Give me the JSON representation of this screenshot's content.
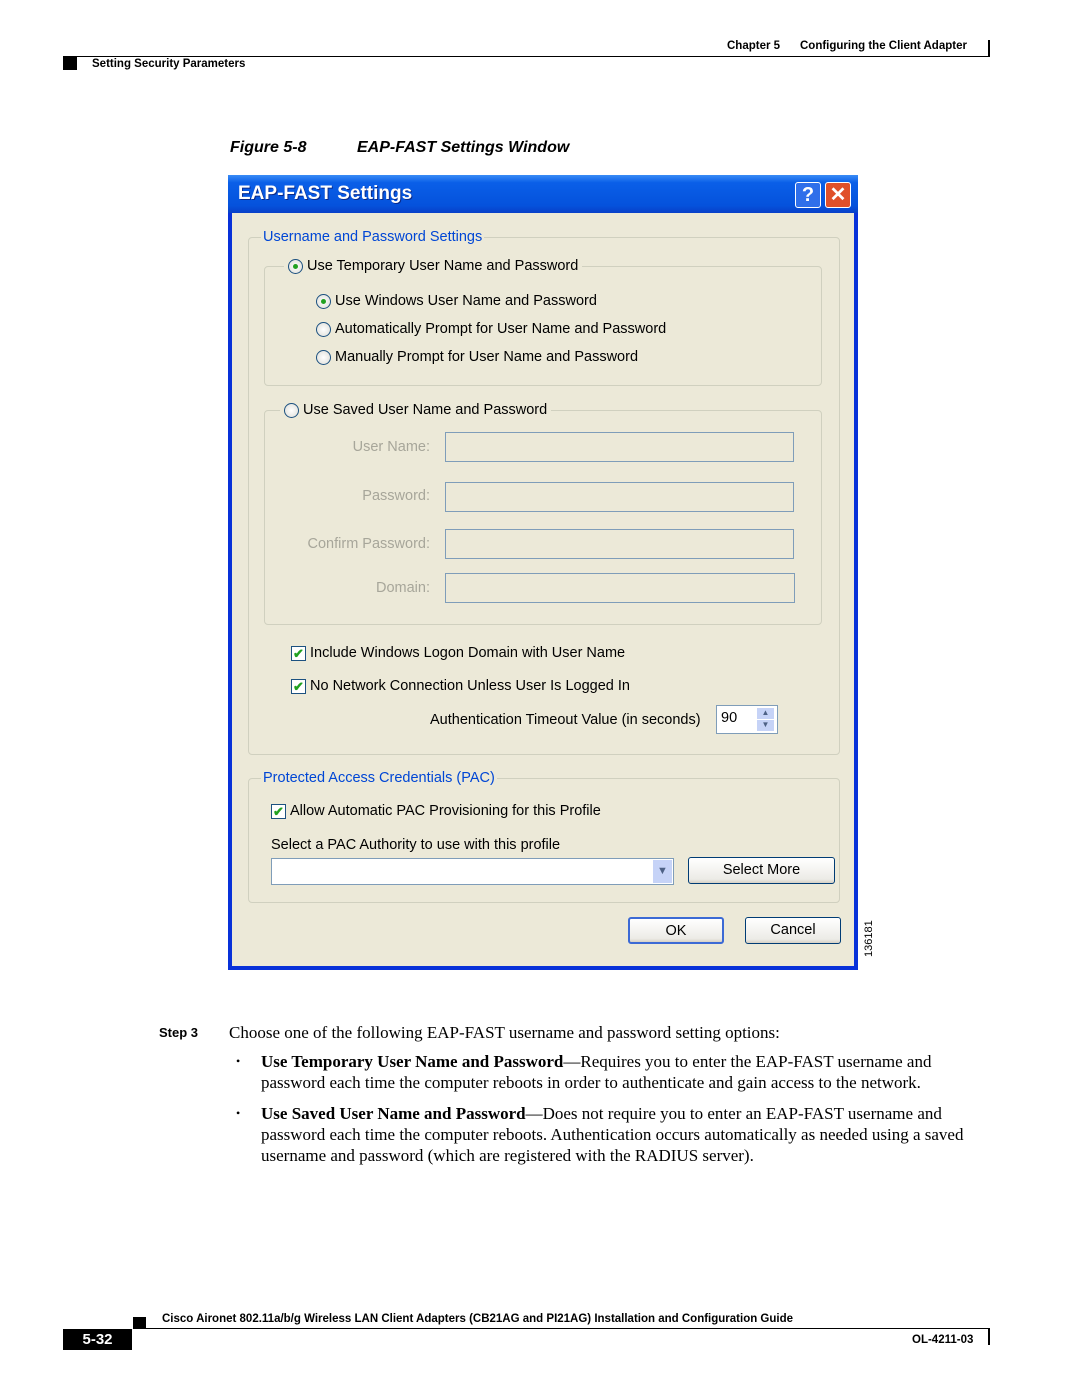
{
  "header": {
    "chapter": "Chapter 5",
    "chapter_title": "Configuring the Client Adapter",
    "section": "Setting Security Parameters"
  },
  "figure": {
    "number": "Figure 5-8",
    "title": "EAP-FAST Settings Window",
    "image_id": "136181"
  },
  "window": {
    "title": "EAP-FAST Settings",
    "help_label": "?",
    "close_label": "✕",
    "username_group": {
      "legend": "Username and Password Settings",
      "temp_radio": {
        "label": "Use Temporary User Name and Password",
        "selected": true
      },
      "sub_radios": [
        {
          "label": "Use Windows User Name and Password",
          "selected": true
        },
        {
          "label": "Automatically Prompt for User Name and Password",
          "selected": false
        },
        {
          "label": "Manually Prompt for User Name and Password",
          "selected": false
        }
      ],
      "saved_radio": {
        "label": "Use Saved User Name and Password",
        "selected": false
      },
      "fields": [
        {
          "label": "User Name:",
          "value": ""
        },
        {
          "label": "Password:",
          "value": ""
        },
        {
          "label": "Confirm Password:",
          "value": ""
        },
        {
          "label": "Domain:",
          "value": ""
        }
      ],
      "checkboxes": [
        {
          "label": "Include Windows Logon Domain with User Name",
          "checked": true
        },
        {
          "label": "No Network Connection Unless User Is Logged In",
          "checked": true
        }
      ],
      "timeout_label": "Authentication Timeout Value (in seconds)",
      "timeout_value": "90"
    },
    "pac_group": {
      "legend": "Protected Access Credentials (PAC)",
      "auto_checkbox": {
        "label": "Allow Automatic PAC Provisioning for this Profile",
        "checked": true
      },
      "authority_label": "Select a PAC Authority to use with this profile",
      "authority_value": "",
      "select_more": "Select More"
    },
    "ok": "OK",
    "cancel": "Cancel"
  },
  "body": {
    "step": "Step 3",
    "intro": "Choose one of the following EAP-FAST username and password setting options:",
    "bullets": [
      {
        "term": "Use Temporary User Name and Password",
        "text": "—Requires you to enter the EAP-FAST username and password each time the computer reboots in order to authenticate and gain access to the network."
      },
      {
        "term": "Use Saved User Name and Password",
        "text": "—Does not require you to enter an EAP-FAST username and password each time the computer reboots. Authentication occurs automatically as needed using a saved username and password (which are registered with the RADIUS server)."
      }
    ]
  },
  "footer": {
    "guide": "Cisco Aironet 802.11a/b/g Wireless LAN Client Adapters (CB21AG and PI21AG) Installation and Configuration Guide",
    "page": "5-32",
    "doc_id": "OL-4211-03"
  }
}
